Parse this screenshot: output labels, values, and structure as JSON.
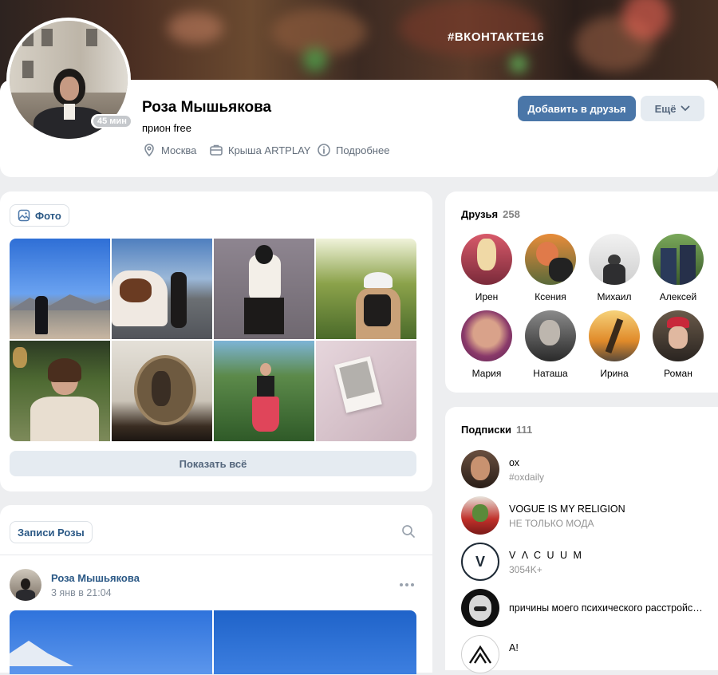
{
  "cover": {
    "hashtag": "#ВКОНТАКТЕ16"
  },
  "profile": {
    "name": "Роза Мышьякова",
    "status": "прион free",
    "online": "45 мин",
    "city": "Москва",
    "work": "Крыша ARTPLAY",
    "details": "Подробнее",
    "add_friend": "Добавить в друзья",
    "more": "Ещё"
  },
  "photos": {
    "tab_label": "Фото",
    "show_all": "Показать всё",
    "items": [
      {
        "name": "photo-mountains"
      },
      {
        "name": "photo-horse"
      },
      {
        "name": "photo-chair"
      },
      {
        "name": "photo-cap"
      },
      {
        "name": "photo-portrait"
      },
      {
        "name": "photo-mirror"
      },
      {
        "name": "photo-garden"
      },
      {
        "name": "photo-polaroid"
      }
    ]
  },
  "posts": {
    "tab_label": "Записи Розы",
    "author": "Роза Мышьякова",
    "date": "3 янв в 21:04"
  },
  "friends": {
    "title": "Друзья",
    "count": "258",
    "items": [
      {
        "name": "Ирен"
      },
      {
        "name": "Ксения"
      },
      {
        "name": "Михаил"
      },
      {
        "name": "Алексей"
      },
      {
        "name": "Мария"
      },
      {
        "name": "Наташа"
      },
      {
        "name": "Ирина"
      },
      {
        "name": "Роман"
      }
    ]
  },
  "subscriptions": {
    "title": "Подписки",
    "count": "111",
    "items": [
      {
        "title": "ох",
        "subtitle": "#oxdaily"
      },
      {
        "title": "VOGUE IS MY RELIGION",
        "subtitle": "НЕ ТОЛЬКО МОДА"
      },
      {
        "title": "V Λ C U U M",
        "subtitle": "3054K+",
        "logo": "V"
      },
      {
        "title": "причины моего психического расстройства",
        "subtitle": ""
      },
      {
        "title": "A!",
        "subtitle": ""
      }
    ]
  },
  "colors": {
    "accent": "#4a76a8",
    "link": "#2a5885",
    "secondary": "#e5ebf1"
  }
}
